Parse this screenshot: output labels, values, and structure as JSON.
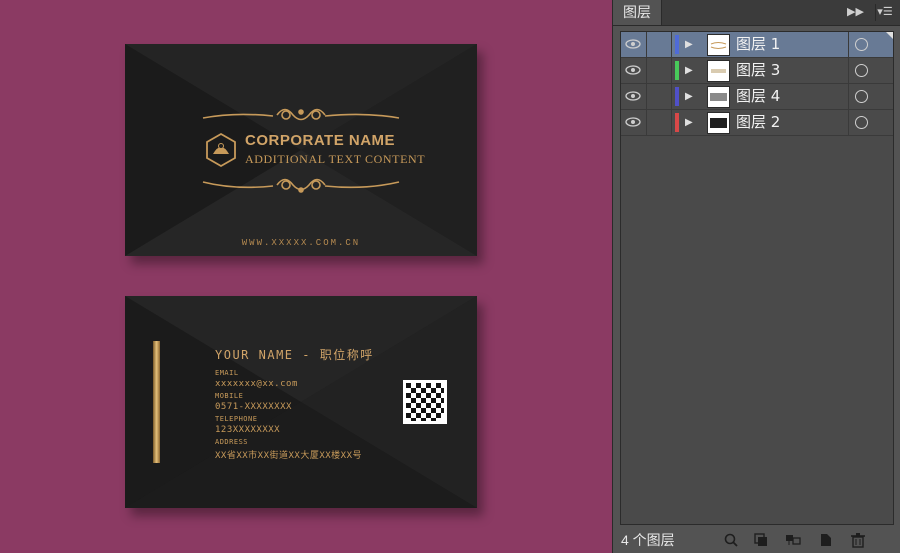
{
  "front_card": {
    "company": "CORPORATE NAME",
    "subtitle": "ADDITIONAL TEXT CONTENT",
    "website": "WWW.XXXXX.COM.CN"
  },
  "back_card": {
    "name_title": "YOUR NAME - 职位称呼",
    "fields": [
      {
        "label": "EMAIL",
        "value": "xxxxxxx@xx.com"
      },
      {
        "label": "MOBILE",
        "value": "0571-XXXXXXXX"
      },
      {
        "label": "TELEPHONE",
        "value": "123XXXXXXXX"
      },
      {
        "label": "ADDRESS",
        "value": "XX省XX市XX街道XX大厦XX楼XX号"
      }
    ]
  },
  "layers_panel": {
    "tab_label": "图层",
    "layers": [
      {
        "name": "图层 1",
        "color": "#4f6bd8",
        "selected": true
      },
      {
        "name": "图层 3",
        "color": "#48c95a",
        "selected": false
      },
      {
        "name": "图层 4",
        "color": "#5050c8",
        "selected": false
      },
      {
        "name": "图层 2",
        "color": "#d84848",
        "selected": false
      }
    ],
    "footer_count": "4 个图层"
  },
  "colors": {
    "canvas_bg": "#8b3a63",
    "gold": "#c79a5a",
    "panel_bg": "#535353",
    "selection": "#687a95"
  }
}
